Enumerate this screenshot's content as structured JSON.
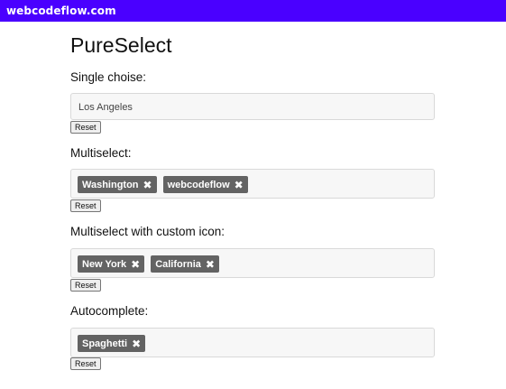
{
  "site": {
    "brand": "webcodeflow.com",
    "brand_color": "#4a00ff"
  },
  "page": {
    "title": "PureSelect"
  },
  "sections": {
    "single": {
      "label": "Single choise:",
      "value": "Los Angeles",
      "reset_label": "Reset"
    },
    "multi": {
      "label": "Multiselect:",
      "tags": [
        "Washington",
        "webcodeflow"
      ],
      "reset_label": "Reset"
    },
    "multi_icon": {
      "label": "Multiselect with custom icon:",
      "tags": [
        "New York",
        "California"
      ],
      "reset_label": "Reset"
    },
    "autocomplete": {
      "label": "Autocomplete:",
      "tags": [
        "Spaghetti"
      ],
      "reset_label": "Reset"
    }
  },
  "icons": {
    "remove_tag": "close-icon"
  },
  "colors": {
    "tag_bg": "#636363",
    "box_bg": "#f7f7f7"
  }
}
